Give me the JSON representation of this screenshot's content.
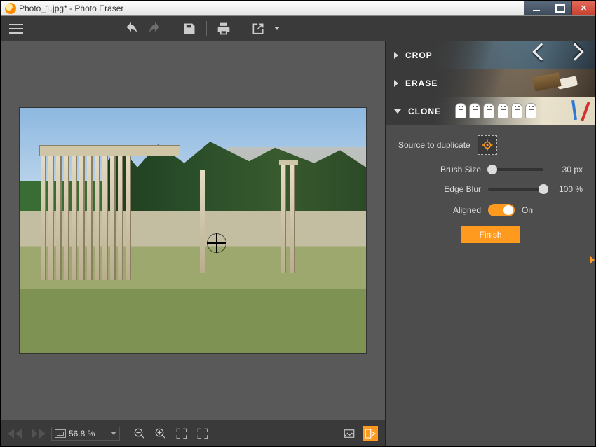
{
  "window": {
    "title": "Photo_1.jpg* - Photo Eraser"
  },
  "panels": {
    "crop": {
      "label": "CROP",
      "expanded": false
    },
    "erase": {
      "label": "ERASE",
      "expanded": false
    },
    "clone": {
      "label": "CLONE",
      "expanded": true,
      "source_label": "Source to duplicate",
      "brush_size_label": "Brush Size",
      "brush_size_value": "30 px",
      "brush_size_pct": 8,
      "edge_blur_label": "Edge Blur",
      "edge_blur_value": "100 %",
      "edge_blur_pct": 100,
      "aligned_label": "Aligned",
      "aligned_state": "On",
      "finish_label": "Finish"
    }
  },
  "bottom": {
    "zoom": "56.8 %"
  }
}
